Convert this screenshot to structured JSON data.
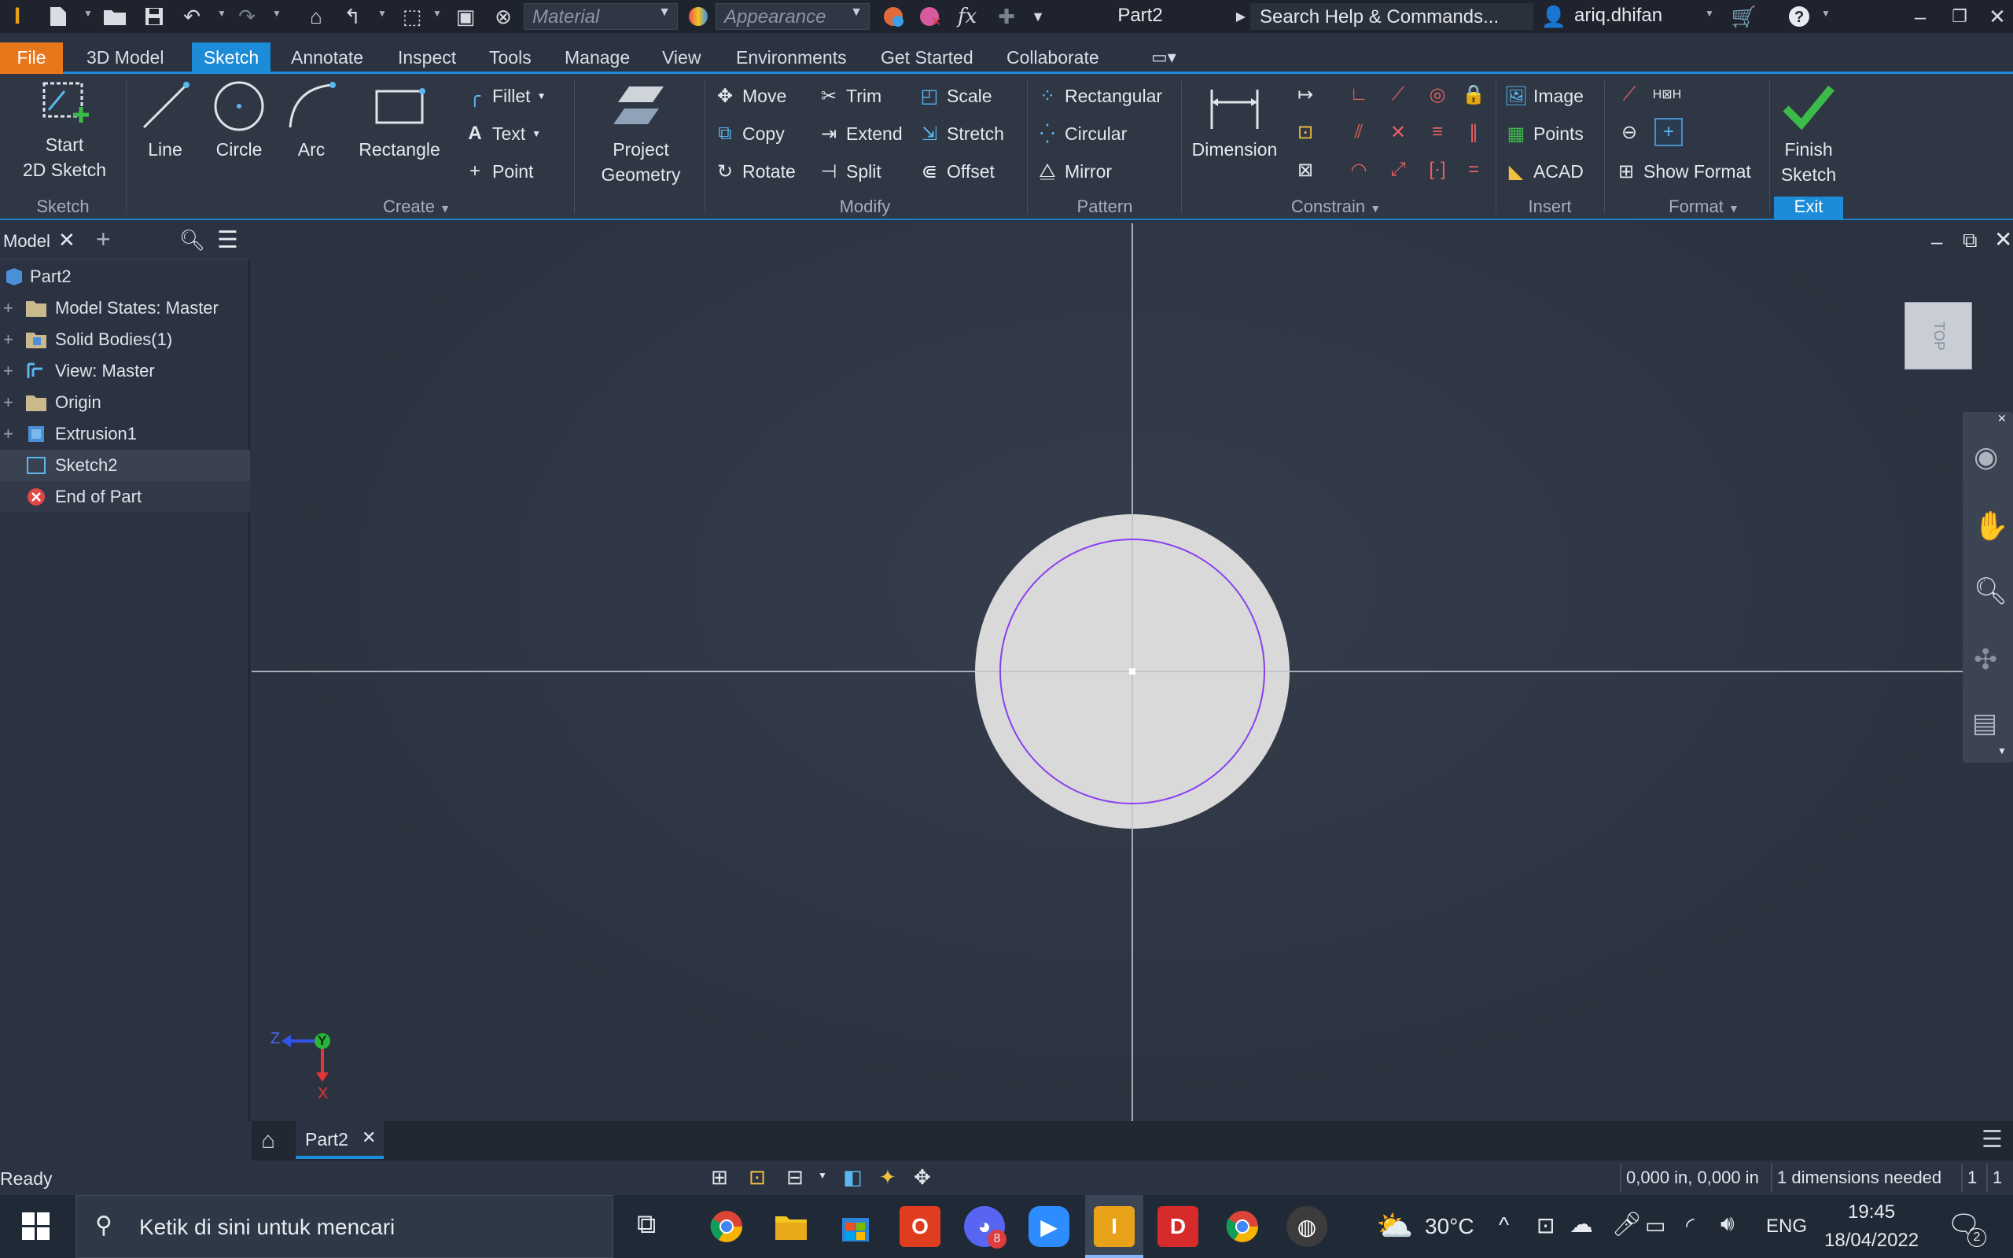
{
  "titlebar": {
    "material_placeholder": "Material",
    "appearance_placeholder": "Appearance",
    "doc_title": "Part2",
    "search_text": "Search Help & Commands...",
    "username": "ariq.dhifan"
  },
  "menu": {
    "tabs": [
      "File",
      "3D Model",
      "Sketch",
      "Annotate",
      "Inspect",
      "Tools",
      "Manage",
      "View",
      "Environments",
      "Get Started",
      "Collaborate"
    ],
    "active": "Sketch"
  },
  "ribbon": {
    "start_sketch": [
      "Start",
      "2D Sketch"
    ],
    "line": "Line",
    "circle": "Circle",
    "arc": "Arc",
    "rectangle": "Rectangle",
    "fillet": "Fillet",
    "text": "Text",
    "point": "Point",
    "project_geometry": [
      "Project",
      "Geometry"
    ],
    "move": "Move",
    "copy": "Copy",
    "rotate": "Rotate",
    "trim": "Trim",
    "extend": "Extend",
    "split": "Split",
    "scale": "Scale",
    "stretch": "Stretch",
    "offset": "Offset",
    "pattern_rect": "Rectangular",
    "pattern_circ": "Circular",
    "mirror": "Mirror",
    "dimension": "Dimension",
    "image": "Image",
    "points": "Points",
    "acad": "ACAD",
    "show_format": "Show Format",
    "finish_sketch": [
      "Finish",
      "Sketch"
    ],
    "panels": {
      "sketch": "Sketch",
      "create": "Create",
      "modify": "Modify",
      "pattern": "Pattern",
      "constrain": "Constrain",
      "insert": "Insert",
      "format": "Format",
      "exit": "Exit"
    }
  },
  "browser": {
    "tab": "Model",
    "items": [
      {
        "label": "Part2",
        "icon": "part-icon"
      },
      {
        "label": "Model States: Master",
        "icon": "folder-icon"
      },
      {
        "label": "Solid Bodies(1)",
        "icon": "folder-icon"
      },
      {
        "label": "View: Master",
        "icon": "view-icon"
      },
      {
        "label": "Origin",
        "icon": "folder-icon"
      },
      {
        "label": "Extrusion1",
        "icon": "extrusion-icon"
      },
      {
        "label": "Sketch2",
        "icon": "sketch-icon"
      },
      {
        "label": "End of Part",
        "icon": "end-of-part-icon"
      }
    ]
  },
  "viewcube": {
    "label": "TOP"
  },
  "triad": {
    "z": "Z",
    "y": "Y",
    "x": "X"
  },
  "doctabs": {
    "tab": "Part2"
  },
  "status": {
    "left": "Ready",
    "coords": "0,000 in, 0,000 in",
    "dims": "1 dimensions needed",
    "n1": "1",
    "n2": "1"
  },
  "taskbar": {
    "search": "Ketik di sini untuk mencari",
    "weather": "30°C",
    "lang": "ENG",
    "time": "19:45",
    "date": "18/04/2022",
    "discord_badge": "8",
    "notif_badge": "2"
  },
  "colors": {
    "accent": "#1c8bd8",
    "file_tab": "#e8761b",
    "sketch_circle": "#8a3ff0",
    "finish_check": "#3dbb4a"
  }
}
